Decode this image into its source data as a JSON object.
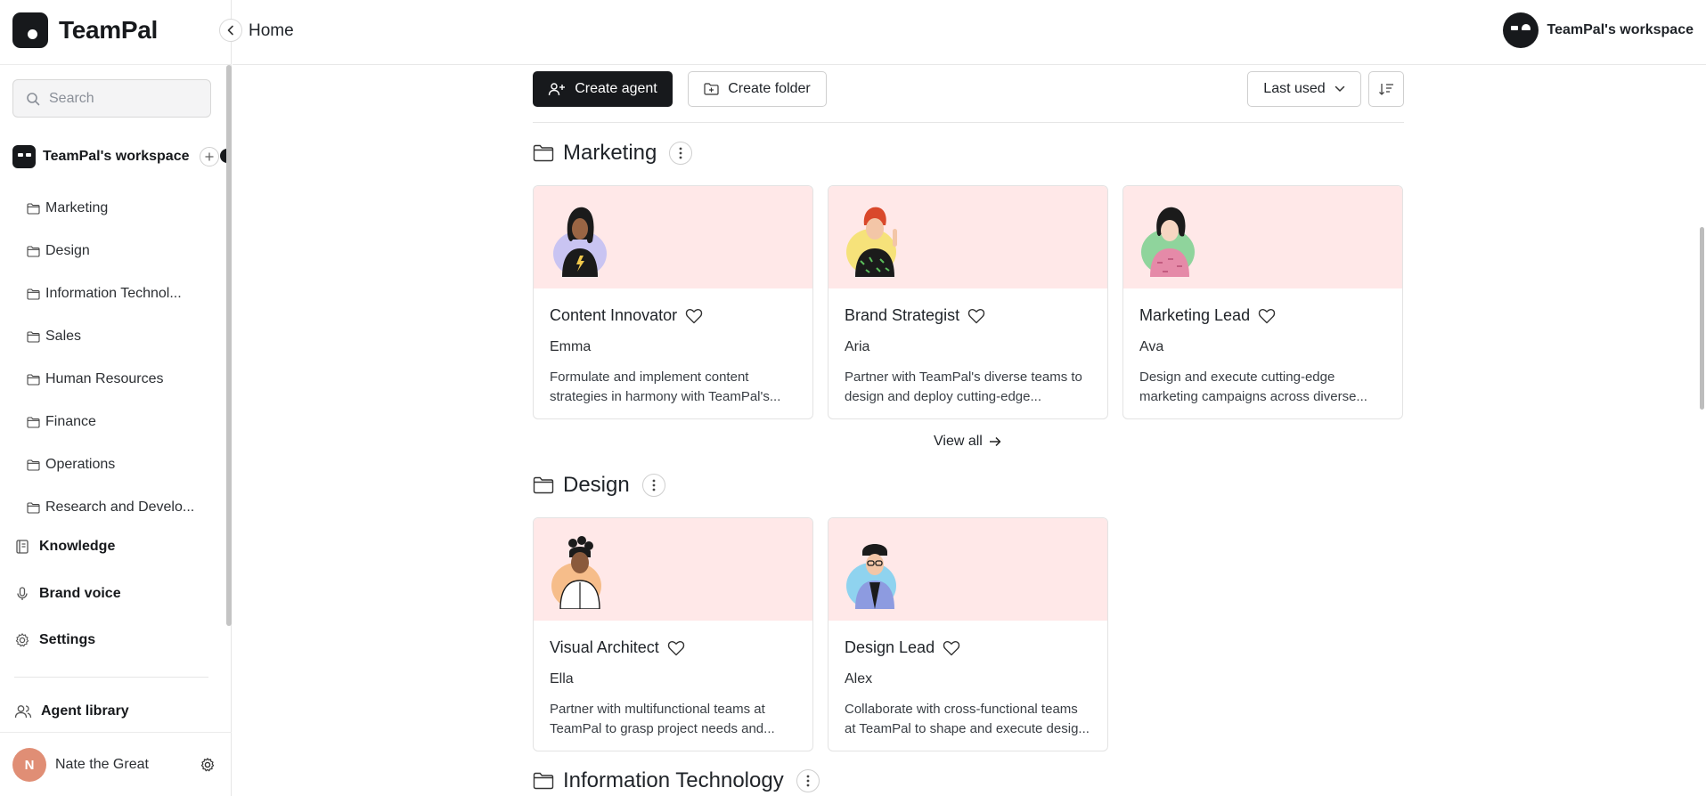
{
  "app": {
    "name": "TeamPal"
  },
  "sidebar": {
    "search_placeholder": "Search",
    "workspace_name": "TeamPal's workspace",
    "folders": [
      "Marketing",
      "Design",
      "Information Technol...",
      "Sales",
      "Human Resources",
      "Finance",
      "Operations",
      "Research and Develo..."
    ],
    "nav": {
      "knowledge": "Knowledge",
      "brand_voice": "Brand voice",
      "settings": "Settings",
      "agent_library": "Agent library"
    },
    "user": {
      "initial": "N",
      "name": "Nate the Great"
    }
  },
  "topbar": {
    "breadcrumb": "Home",
    "workspace_name": "TeamPal's workspace"
  },
  "toolbar": {
    "create_agent": "Create agent",
    "create_folder": "Create folder",
    "sort_value": "Last used"
  },
  "sections": [
    {
      "title": "Marketing",
      "view_all": "View all",
      "agents": [
        {
          "role": "Content Innovator",
          "name": "Emma",
          "desc": "Formulate and implement content strategies in harmony with TeamPal's..."
        },
        {
          "role": "Brand Strategist",
          "name": "Aria",
          "desc": "Partner with TeamPal's diverse teams to design and deploy cutting-edge..."
        },
        {
          "role": "Marketing Lead",
          "name": "Ava",
          "desc": "Design and execute cutting-edge marketing campaigns across diverse..."
        }
      ]
    },
    {
      "title": "Design",
      "agents": [
        {
          "role": "Visual Architect",
          "name": "Ella",
          "desc": "Partner with multifunctional teams at TeamPal to grasp project needs and..."
        },
        {
          "role": "Design Lead",
          "name": "Alex",
          "desc": "Collaborate with cross-functional teams at TeamPal to shape and execute desig..."
        }
      ]
    },
    {
      "title": "Information Technology"
    }
  ],
  "colors": {
    "primary": "#17191c",
    "card_header": "#ffe8e8",
    "user_avatar": "#e08e75"
  }
}
